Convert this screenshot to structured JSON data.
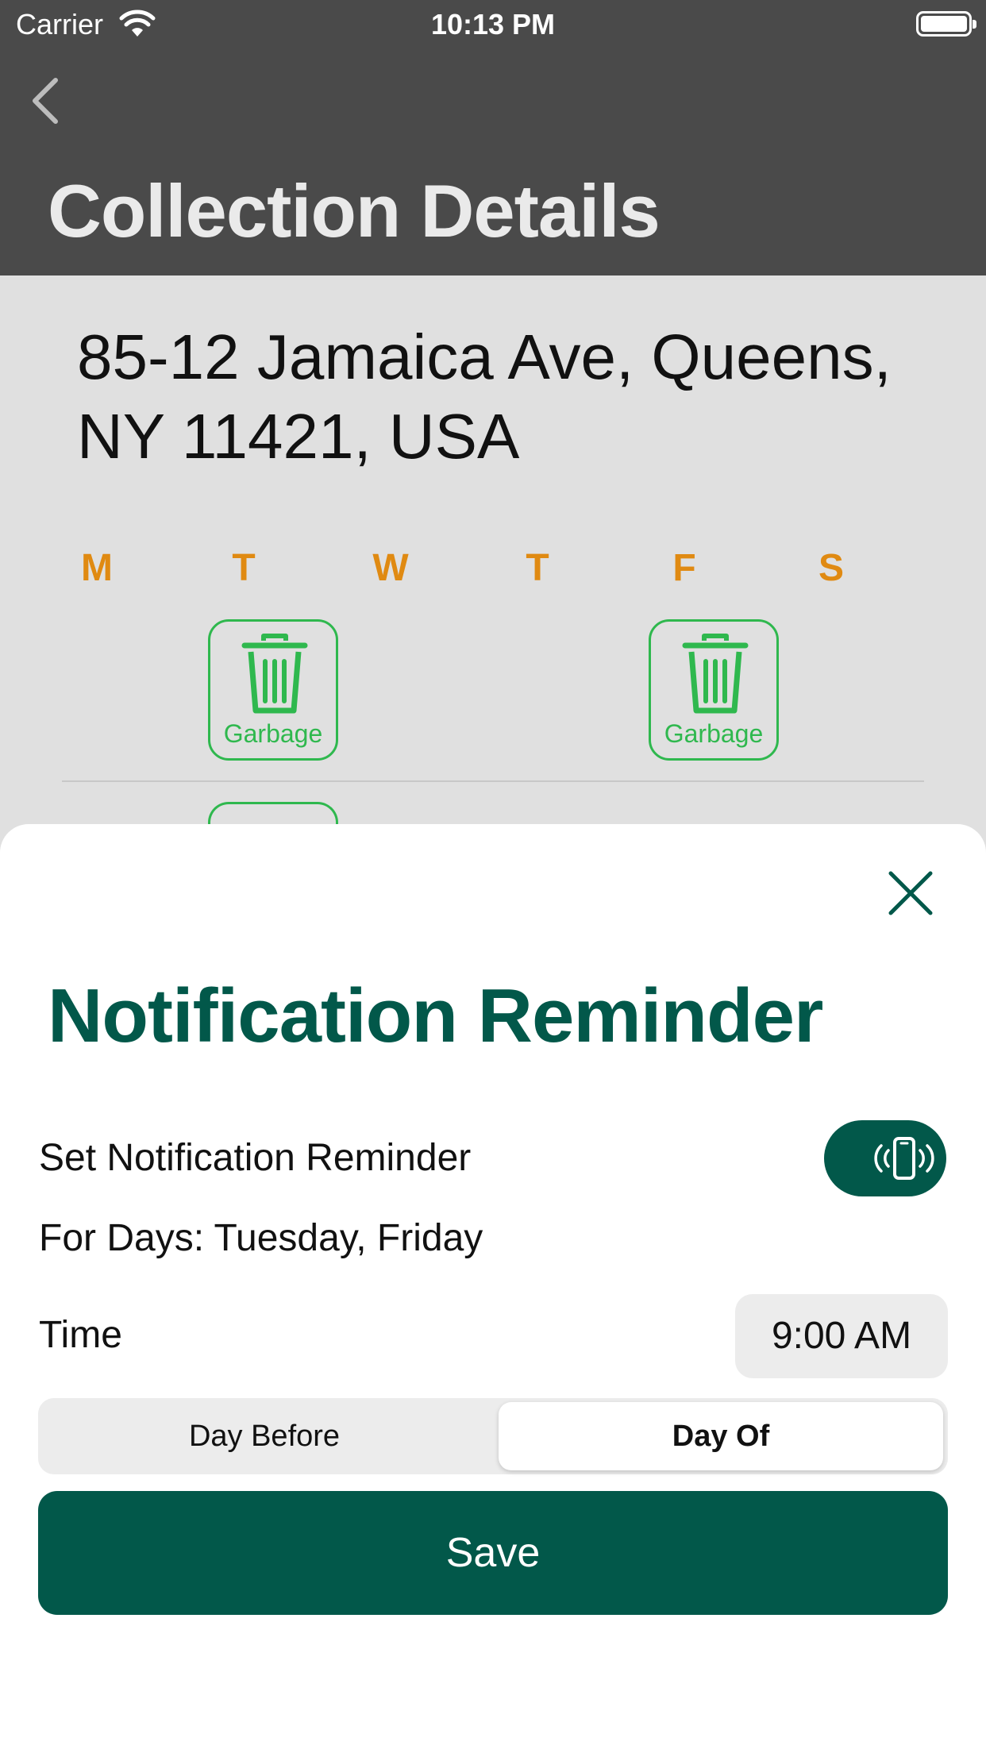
{
  "status_bar": {
    "carrier": "Carrier",
    "time": "10:13 PM"
  },
  "nav": {
    "title": "Collection Details"
  },
  "address": {
    "text": "85-12 Jamaica Ave, Queens, NY 11421, USA"
  },
  "calendar": {
    "weekdays": [
      "M",
      "T",
      "W",
      "T",
      "F",
      "S"
    ],
    "collections": [
      {
        "day": "T",
        "label": "Garbage",
        "icon": "trash-icon"
      },
      {
        "day": "F",
        "label": "Garbage",
        "icon": "trash-icon"
      }
    ]
  },
  "sheet": {
    "title": "Notification Reminder",
    "set_label": "Set Notification Reminder",
    "toggle": {
      "on": true,
      "icon": "phone-vibrate-icon"
    },
    "days_label": "For Days: Tuesday, Friday",
    "time_label": "Time",
    "time_value": "9:00 AM",
    "segments": {
      "left": "Day Before",
      "right": "Day Of",
      "selected": "Day Of"
    },
    "save_label": "Save"
  },
  "colors": {
    "header_bg": "#4a4a4a",
    "weekday": "#e08a12",
    "garbage": "#2fb84e",
    "brand": "#02584a"
  }
}
